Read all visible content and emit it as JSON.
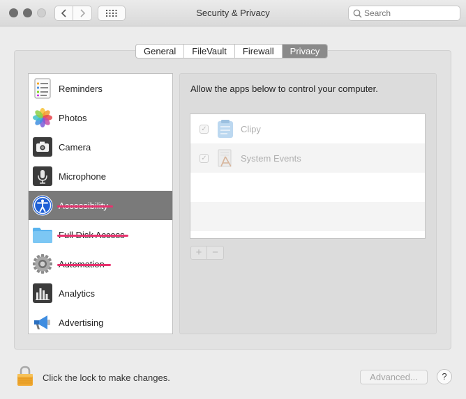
{
  "window": {
    "title": "Security & Privacy"
  },
  "search": {
    "placeholder": "Search"
  },
  "tabs": [
    {
      "label": "General",
      "active": false
    },
    {
      "label": "FileVault",
      "active": false
    },
    {
      "label": "Firewall",
      "active": false
    },
    {
      "label": "Privacy",
      "active": true
    }
  ],
  "sidebar": {
    "items": [
      {
        "label": "Reminders",
        "icon": "reminders-icon",
        "selected": false
      },
      {
        "label": "Photos",
        "icon": "photos-icon",
        "selected": false
      },
      {
        "label": "Camera",
        "icon": "camera-icon",
        "selected": false
      },
      {
        "label": "Microphone",
        "icon": "microphone-icon",
        "selected": false
      },
      {
        "label": "Accessibility",
        "icon": "accessibility-icon",
        "selected": true
      },
      {
        "label": "Full Disk Access",
        "icon": "folder-icon",
        "selected": false
      },
      {
        "label": "Automation",
        "icon": "gear-icon",
        "selected": false
      },
      {
        "label": "Analytics",
        "icon": "analytics-icon",
        "selected": false
      },
      {
        "label": "Advertising",
        "icon": "megaphone-icon",
        "selected": false
      }
    ]
  },
  "main": {
    "description": "Allow the apps below to control your computer.",
    "apps": [
      {
        "name": "Clipy",
        "checked": true,
        "icon": "clipy-app-icon"
      },
      {
        "name": "System Events",
        "checked": true,
        "icon": "system-events-app-icon"
      }
    ],
    "add_label": "+",
    "remove_label": "−"
  },
  "footer": {
    "lock_text": "Click the lock to make changes.",
    "advanced_label": "Advanced...",
    "help_label": "?"
  },
  "colors": {
    "selection": "#7a7a7a",
    "annotation_underline": "#e8326e",
    "active_tab": "#8a8a8a"
  }
}
